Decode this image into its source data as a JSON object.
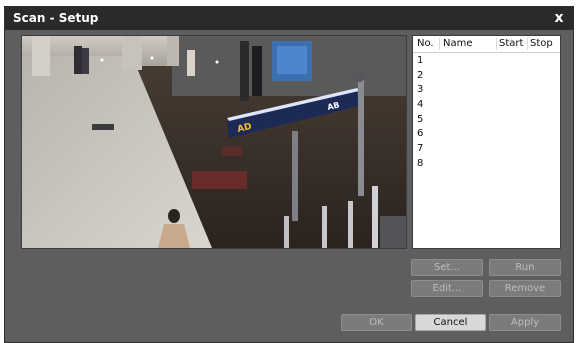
{
  "window": {
    "title": "Scan - Setup",
    "close_glyph": "x"
  },
  "list": {
    "columns": [
      "No.",
      "Name",
      "Start",
      "Stop"
    ],
    "rows": [
      "1",
      "2",
      "3",
      "4",
      "5",
      "6",
      "7",
      "8"
    ]
  },
  "list_buttons": {
    "set": "Set...",
    "run": "Run",
    "edit": "Edit...",
    "remove": "Remove"
  },
  "footer_buttons": {
    "ok": "OK",
    "cancel": "Cancel",
    "apply": "Apply"
  },
  "camera_sign": {
    "left": "AD",
    "right": "AB"
  },
  "colors": {
    "title_bar": "#2a2a2a",
    "dialog_bg": "#5e5e5e",
    "button_disabled": "#7b7b7b",
    "button_active": "#d8d8d8"
  }
}
